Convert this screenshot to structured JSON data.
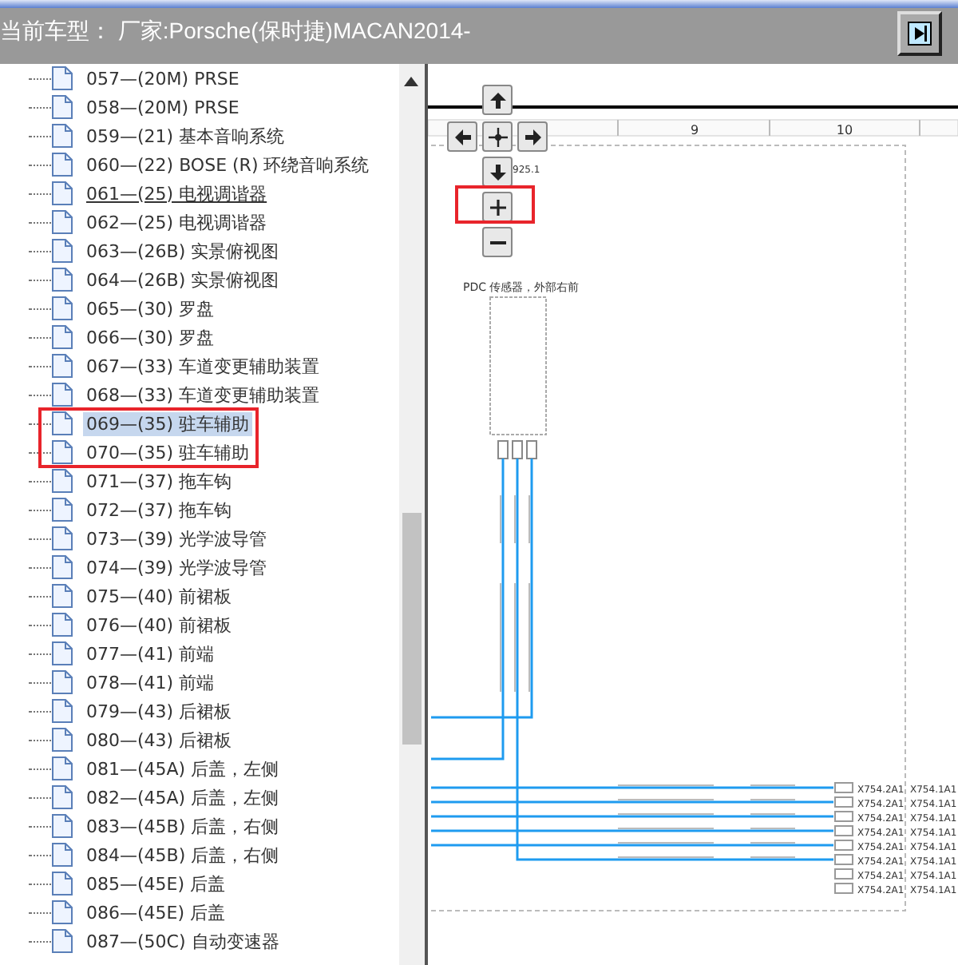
{
  "header": {
    "title": "当前车型： 厂家:Porsche(保时捷)MACAN2014-"
  },
  "tree": {
    "items": [
      {
        "label": "057—(20M) PRSE",
        "selected": false,
        "hovered": false
      },
      {
        "label": "058—(20M) PRSE",
        "selected": false,
        "hovered": false
      },
      {
        "label": "059—(21) 基本音响系统",
        "selected": false,
        "hovered": false
      },
      {
        "label": "060—(22) BOSE (R) 环绕音响系统",
        "selected": false,
        "hovered": false
      },
      {
        "label": "061—(25) 电视调谐器",
        "selected": false,
        "hovered": true
      },
      {
        "label": "062—(25) 电视调谐器",
        "selected": false,
        "hovered": false
      },
      {
        "label": "063—(26B) 实景俯视图",
        "selected": false,
        "hovered": false
      },
      {
        "label": "064—(26B) 实景俯视图",
        "selected": false,
        "hovered": false
      },
      {
        "label": "065—(30) 罗盘",
        "selected": false,
        "hovered": false
      },
      {
        "label": "066—(30) 罗盘",
        "selected": false,
        "hovered": false
      },
      {
        "label": "067—(33) 车道变更辅助装置",
        "selected": false,
        "hovered": false
      },
      {
        "label": "068—(33) 车道变更辅助装置",
        "selected": false,
        "hovered": false
      },
      {
        "label": "069—(35) 驻车辅助",
        "selected": true,
        "hovered": false
      },
      {
        "label": "070—(35) 驻车辅助",
        "selected": false,
        "hovered": false
      },
      {
        "label": "071—(37) 拖车钩",
        "selected": false,
        "hovered": false
      },
      {
        "label": "072—(37) 拖车钩",
        "selected": false,
        "hovered": false
      },
      {
        "label": "073—(39) 光学波导管",
        "selected": false,
        "hovered": false
      },
      {
        "label": "074—(39) 光学波导管",
        "selected": false,
        "hovered": false
      },
      {
        "label": "075—(40) 前裙板",
        "selected": false,
        "hovered": false
      },
      {
        "label": "076—(40) 前裙板",
        "selected": false,
        "hovered": false
      },
      {
        "label": "077—(41) 前端",
        "selected": false,
        "hovered": false
      },
      {
        "label": "078—(41) 前端",
        "selected": false,
        "hovered": false
      },
      {
        "label": "079—(43) 后裙板",
        "selected": false,
        "hovered": false
      },
      {
        "label": "080—(43) 后裙板",
        "selected": false,
        "hovered": false
      },
      {
        "label": "081—(45A) 后盖，左侧",
        "selected": false,
        "hovered": false
      },
      {
        "label": "082—(45A) 后盖，左侧",
        "selected": false,
        "hovered": false
      },
      {
        "label": "083—(45B) 后盖，右侧",
        "selected": false,
        "hovered": false
      },
      {
        "label": "084—(45B) 后盖，右侧",
        "selected": false,
        "hovered": false
      },
      {
        "label": "085—(45E) 后盖",
        "selected": false,
        "hovered": false
      },
      {
        "label": "086—(45E) 后盖",
        "selected": false,
        "hovered": false
      },
      {
        "label": "087—(50C) 自动变速器",
        "selected": false,
        "hovered": false
      }
    ]
  },
  "diagram": {
    "columns": [
      "9",
      "10"
    ],
    "reference": "925.1",
    "component": "PDC 传感器，外部右前",
    "pins": [
      {
        "left": "X754.2A1",
        "right": "X754.1A1"
      },
      {
        "left": "X754.2A1",
        "right": "X754.1A1"
      },
      {
        "left": "X754.2A1",
        "right": "X754.1A1"
      },
      {
        "left": "X754.2A1",
        "right": "X754.1A1"
      },
      {
        "left": "X754.2A1",
        "right": "X754.1A1"
      },
      {
        "left": "X754.2A1",
        "right": "X754.1A1"
      },
      {
        "left": "X754.2A1",
        "right": "X754.1A1"
      },
      {
        "left": "X754.2A1",
        "right": "X754.1A1"
      }
    ]
  }
}
